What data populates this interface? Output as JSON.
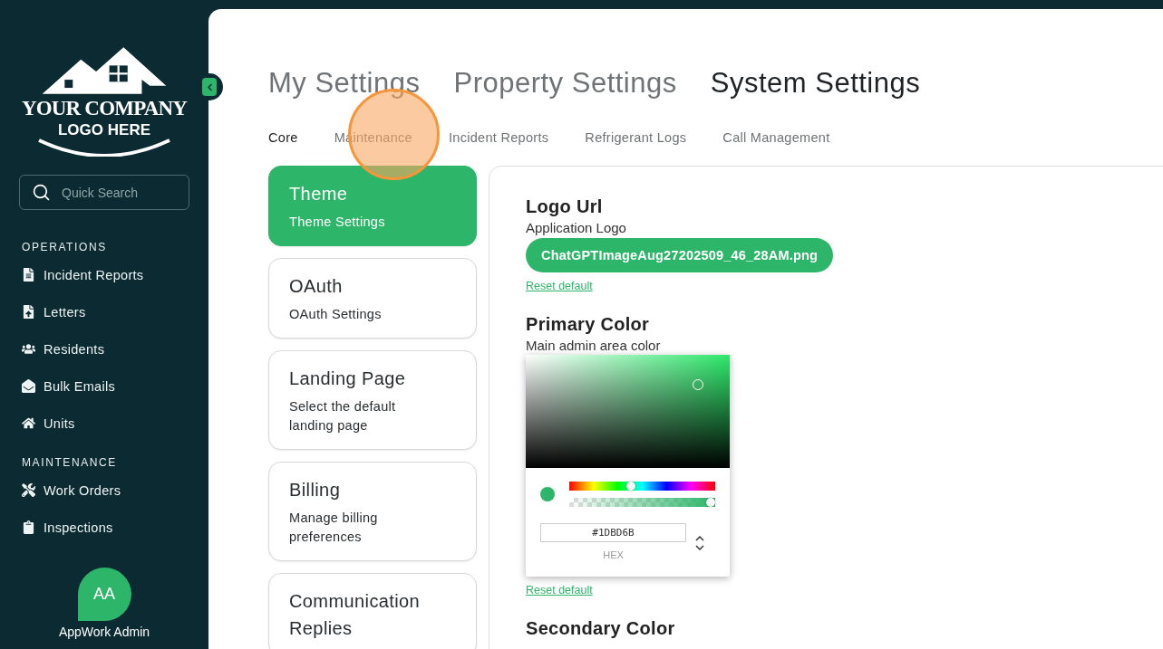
{
  "sidebar": {
    "logo": {
      "line_1": "YOUR COMPANY",
      "line_2": "LOGO HERE"
    },
    "search": {
      "placeholder": "Quick Search"
    },
    "sections": [
      {
        "title": "OPERATIONS",
        "items": [
          {
            "label": "Incident Reports"
          },
          {
            "label": "Letters"
          },
          {
            "label": "Residents"
          },
          {
            "label": "Bulk Emails"
          },
          {
            "label": "Units"
          }
        ]
      },
      {
        "title": "MAINTENANCE",
        "items": [
          {
            "label": "Work Orders"
          },
          {
            "label": "Inspections"
          }
        ]
      }
    ],
    "user": {
      "initials": "AA",
      "name": "AppWork Admin"
    }
  },
  "top_tabs": [
    {
      "label": "My Settings",
      "selected": false
    },
    {
      "label": "Property Settings",
      "selected": false
    },
    {
      "label": "System Settings",
      "selected": true
    }
  ],
  "sub_tabs": [
    {
      "label": "Core",
      "selected": true
    },
    {
      "label": "Maintenance",
      "selected": false
    },
    {
      "label": "Incident Reports",
      "selected": false
    },
    {
      "label": "Refrigerant Logs",
      "selected": false
    },
    {
      "label": "Call Management",
      "selected": false
    }
  ],
  "setting_cards": [
    {
      "title": "Theme",
      "subtitle": "Theme Settings",
      "selected": true
    },
    {
      "title": "OAuth",
      "subtitle": "OAuth Settings",
      "selected": false
    },
    {
      "title": "Landing Page",
      "subtitle": "Select the default landing page",
      "selected": false
    },
    {
      "title": "Billing",
      "subtitle": "Manage billing preferences",
      "selected": false
    },
    {
      "title": "Communication Replies",
      "selected": false
    }
  ],
  "fields": [
    {
      "kind": "file",
      "title": "Logo Url",
      "description": "Application Logo",
      "file_name": "ChatGPTImageAug27202509_46_28AM.png",
      "reset_link": "Reset default"
    },
    {
      "kind": "color",
      "title": "Primary Color",
      "description": "Main admin area color",
      "picker": {
        "hue": {
          "level": 0.42
        },
        "alpha": {
          "level": 1
        },
        "value": "#1DBD6B",
        "format": "HEX"
      },
      "reset_link": "Reset default"
    },
    {
      "kind": "color",
      "title": "Secondary Color"
    }
  ]
}
